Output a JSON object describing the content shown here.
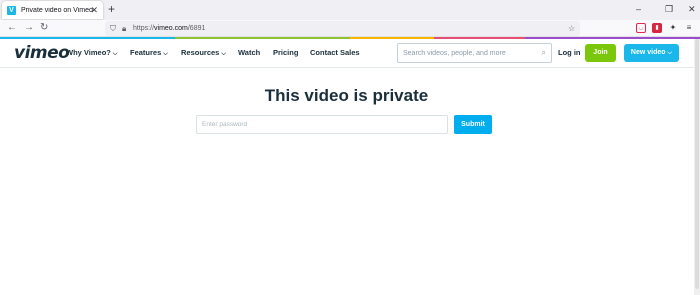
{
  "browser": {
    "tab": {
      "title": "Private video on Vimeo",
      "favicon": "V"
    },
    "url": {
      "prefix": "https://",
      "host": "vimeo.com",
      "path": "/6891"
    }
  },
  "vimeo": {
    "logo": "vimeo",
    "nav": [
      {
        "label": "Why Vimeo?",
        "dropdown": true
      },
      {
        "label": "Features",
        "dropdown": true
      },
      {
        "label": "Resources",
        "dropdown": true
      },
      {
        "label": "Watch",
        "dropdown": false
      },
      {
        "label": "Pricing",
        "dropdown": false
      },
      {
        "label": "Contact Sales",
        "dropdown": false
      }
    ],
    "search_placeholder": "Search videos, people, and more",
    "login": "Log in",
    "join": "Join",
    "new_video": "New video",
    "accent_color": "#1ab7ea",
    "join_color": "#7ac70c"
  },
  "page": {
    "title": "This video is private",
    "password_placeholder": "Enter password",
    "submit": "Submit"
  }
}
